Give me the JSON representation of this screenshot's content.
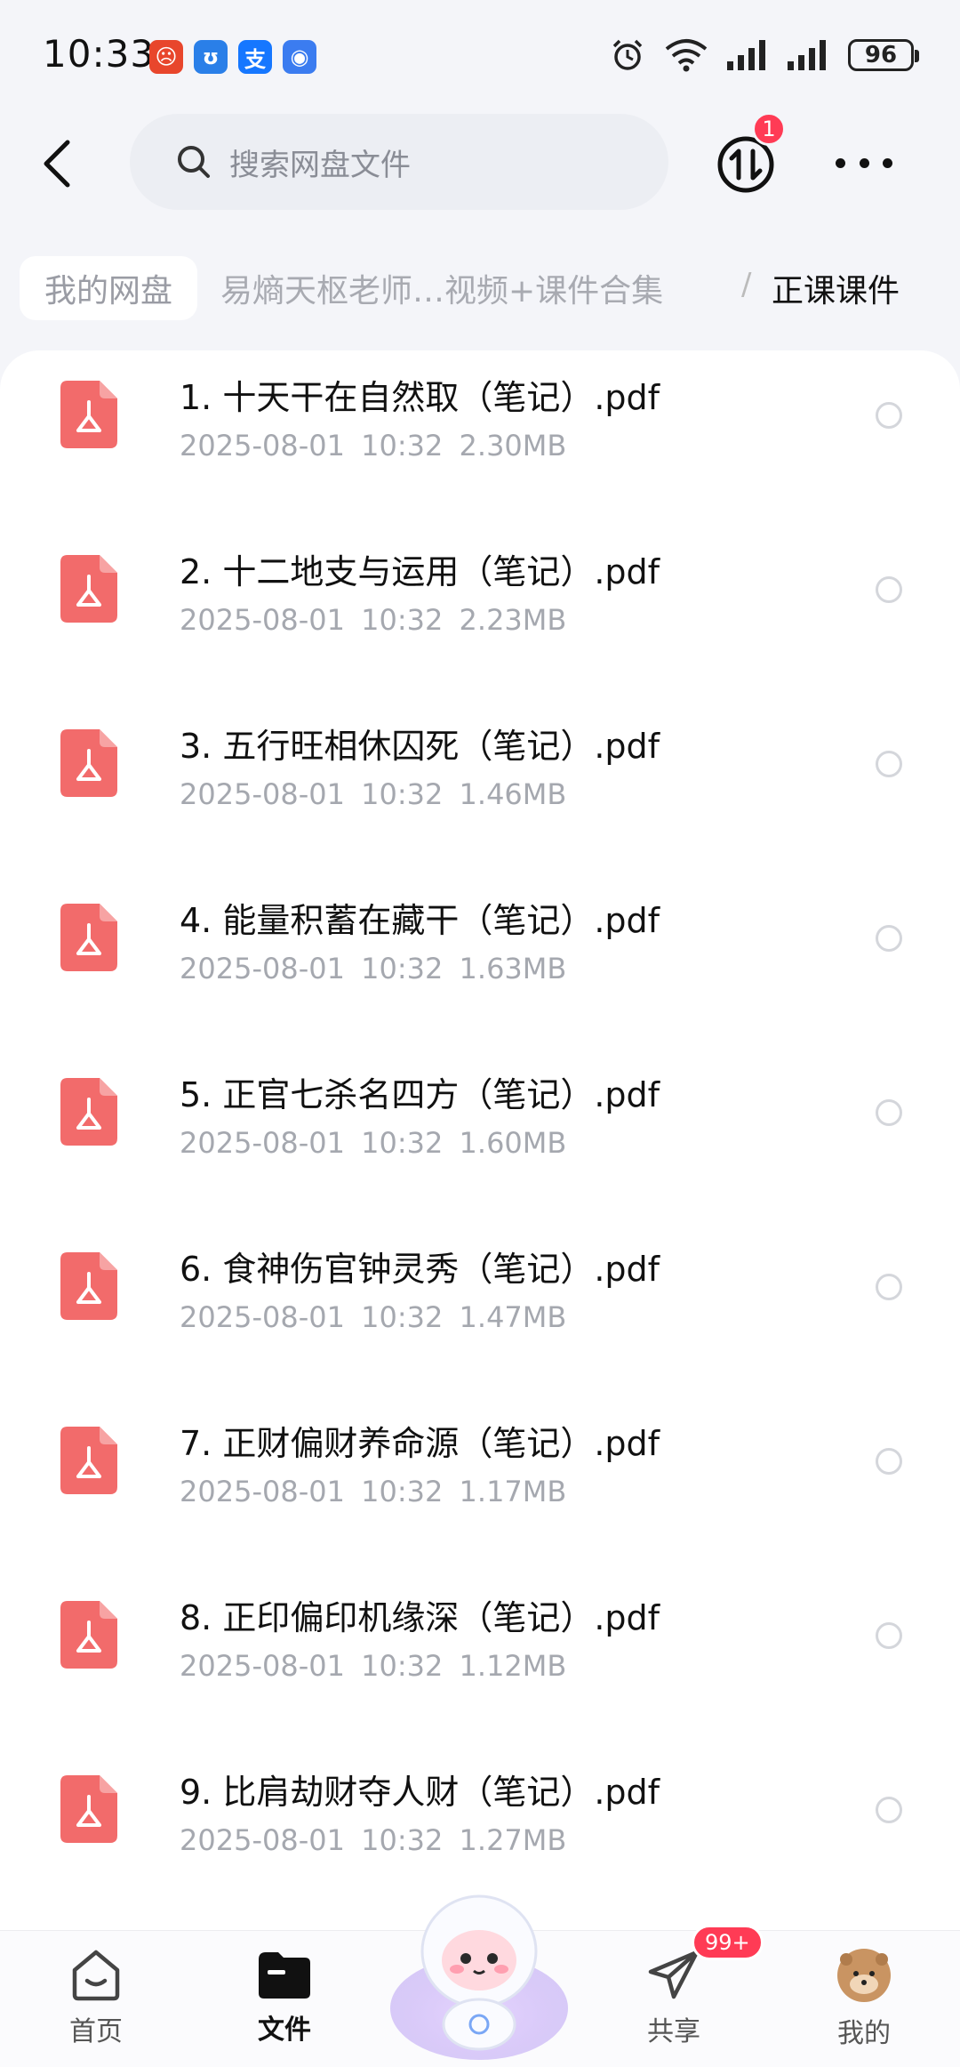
{
  "status_bar": {
    "time": "10:33",
    "battery": "96",
    "app_icons": [
      {
        "name": "app-red-icon",
        "color": "#e8462c",
        "glyph": "☹"
      },
      {
        "name": "app-blue-icon",
        "color": "#2a7fe8",
        "glyph": "ʊ"
      },
      {
        "name": "alipay-icon",
        "color": "#1677ff",
        "glyph": "支"
      },
      {
        "name": "app-blue2-icon",
        "color": "#3b7cf0",
        "glyph": "◉"
      }
    ]
  },
  "header": {
    "search_placeholder": "搜索网盘文件",
    "transfer_badge": "1"
  },
  "breadcrumb": {
    "root": "我的网盘",
    "middle": "易熵天枢老师…视频+课件合集",
    "separator": "/",
    "current": "正课课件"
  },
  "files": [
    {
      "name": "1. 十天干在自然取（笔记）.pdf",
      "date": "2025-08-01",
      "time": "10:32",
      "size": "2.30MB"
    },
    {
      "name": "2. 十二地支与运用（笔记）.pdf",
      "date": "2025-08-01",
      "time": "10:32",
      "size": "2.23MB"
    },
    {
      "name": "3. 五行旺相休囚死（笔记）.pdf",
      "date": "2025-08-01",
      "time": "10:32",
      "size": "1.46MB"
    },
    {
      "name": "4. 能量积蓄在藏干（笔记）.pdf",
      "date": "2025-08-01",
      "time": "10:32",
      "size": "1.63MB"
    },
    {
      "name": "5. 正官七杀名四方（笔记）.pdf",
      "date": "2025-08-01",
      "time": "10:32",
      "size": "1.60MB"
    },
    {
      "name": "6. 食神伤官钟灵秀（笔记）.pdf",
      "date": "2025-08-01",
      "time": "10:32",
      "size": "1.47MB"
    },
    {
      "name": "7. 正财偏财养命源（笔记）.pdf",
      "date": "2025-08-01",
      "time": "10:32",
      "size": "1.17MB"
    },
    {
      "name": "8. 正印偏印机缘深（笔记）.pdf",
      "date": "2025-08-01",
      "time": "10:32",
      "size": "1.12MB"
    },
    {
      "name": "9. 比肩劫财夺人财（笔记）.pdf",
      "date": "2025-08-01",
      "time": "10:32",
      "size": "1.27MB"
    }
  ],
  "bottom_nav": {
    "home": "首页",
    "files": "文件",
    "share": "共享",
    "share_badge": "99+",
    "me": "我的"
  },
  "colors": {
    "pdf_red": "#f26b6b",
    "badge_red": "#ff3b55",
    "accent_text": "#111111"
  }
}
